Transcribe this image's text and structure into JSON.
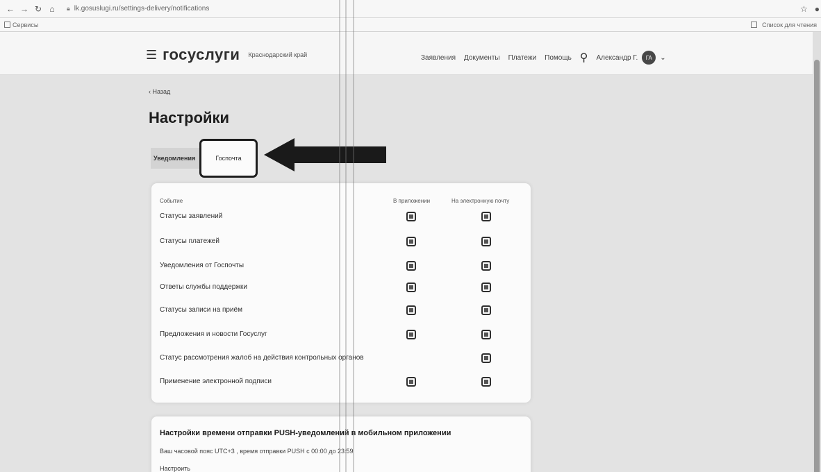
{
  "browser": {
    "url": "lk.gosuslugi.ru/settings-delivery/notifications",
    "bookmark_left": "Сервисы",
    "bookmark_right": "Список для чтения"
  },
  "header": {
    "logo": "госуслуги",
    "region": "Краснодарский край",
    "nav": [
      "Заявления",
      "Документы",
      "Платежи",
      "Помощь"
    ],
    "user_name": "Александр Г.",
    "avatar_initials": "ГА"
  },
  "page": {
    "back": "‹ Назад",
    "title": "Настройки",
    "tabs": [
      "Уведомления",
      "Госпочта"
    ]
  },
  "table": {
    "col_event": "Событие",
    "col_app": "В приложении",
    "col_email": "На электронную почту",
    "rows": [
      {
        "label": "Статусы заявлений",
        "app": true,
        "email": true
      },
      {
        "label": "Статусы платежей",
        "app": true,
        "email": true
      },
      {
        "label": "Уведомления от Госпочты",
        "app": true,
        "email": true
      },
      {
        "label": "Ответы службы поддержки",
        "app": true,
        "email": true
      },
      {
        "label": "Статусы записи на приём",
        "app": true,
        "email": true
      },
      {
        "label": "Предложения и новости Госуслуг",
        "app": true,
        "email": true
      },
      {
        "label": "Статус рассмотрения жалоб на действия контрольных органов",
        "app": false,
        "email": true
      },
      {
        "label": "Применение электронной подписи",
        "app": true,
        "email": true
      }
    ]
  },
  "push": {
    "title": "Настройки времени отправки PUSH-уведомлений в мобильном приложении",
    "text": "Ваш часовой пояс UTC+3 , время отправки PUSH с 00:00 до 23:59",
    "link": "Настроить"
  }
}
